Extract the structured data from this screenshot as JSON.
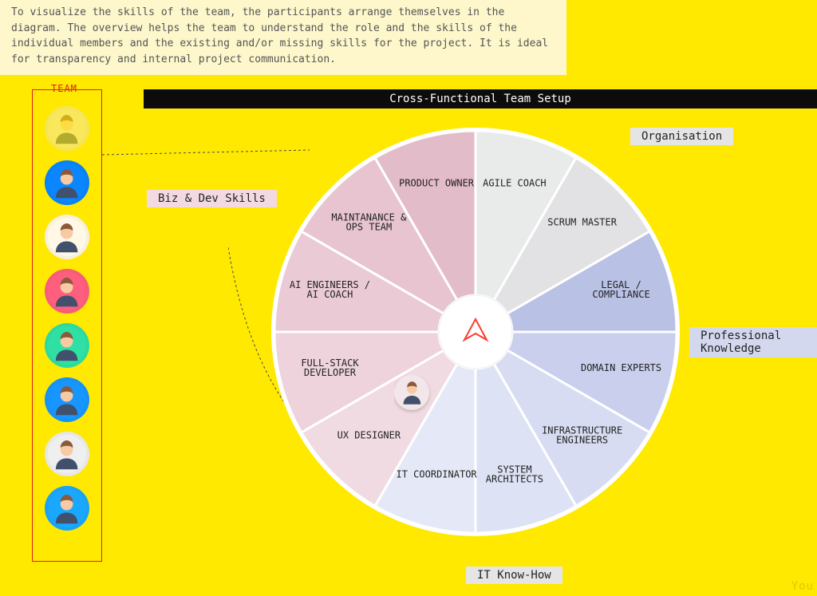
{
  "intro": "To visualize the skills of the team, the participants arrange themselves in the diagram. The overview helps the team to understand the role and the skills of the individual members and the existing and/or missing skills for the project. It is ideal for transparency and internal project communication.",
  "title": "Cross-Functional Team Setup",
  "team_caption": "TEAM",
  "team": [
    {
      "id": "member-1",
      "bg": "#f2e6ea"
    },
    {
      "id": "member-2",
      "bg": "#0a86ff"
    },
    {
      "id": "member-3",
      "bg": "#fff8e7"
    },
    {
      "id": "member-4",
      "bg": "#ff5f7e"
    },
    {
      "id": "member-5",
      "bg": "#2fe0a4"
    },
    {
      "id": "member-6",
      "bg": "#1796ff"
    },
    {
      "id": "member-7",
      "bg": "#efefef"
    },
    {
      "id": "member-8",
      "bg": "#1aa8ff"
    }
  ],
  "quadrants": {
    "top_left": {
      "label": "Biz & Dev Skills"
    },
    "top_right": {
      "label": "Organisation"
    },
    "bottom_right": {
      "label": "Professional Knowledge"
    },
    "bottom_left": {
      "label": "IT Know-How"
    }
  },
  "watermark": "You",
  "chart_data": {
    "type": "pie",
    "title": "Cross-Functional Team Setup",
    "slices": [
      {
        "id": "agile-coach",
        "label": "AGILE COACH",
        "group": "Organisation",
        "color": "#e9eaea"
      },
      {
        "id": "scrum-master",
        "label": "SCRUM MASTER",
        "group": "Organisation",
        "color": "#e2e2e4"
      },
      {
        "id": "legal",
        "label": "LEGAL / COMPLIANCE",
        "group": "Professional Knowledge",
        "color": "#b9c1e5"
      },
      {
        "id": "domain-experts",
        "label": "DOMAIN EXPERTS",
        "group": "Professional Knowledge",
        "color": "#c9cfed"
      },
      {
        "id": "infra-eng",
        "label": "INFRASTRUCTURE ENGINEERS",
        "group": "IT Know-How",
        "color": "#d7dcf2"
      },
      {
        "id": "sys-arch",
        "label": "SYSTEM ARCHITECTS",
        "group": "IT Know-How",
        "color": "#dde2f5"
      },
      {
        "id": "it-coord",
        "label": "IT COORDINATOR",
        "group": "IT Know-How",
        "color": "#e5e9f7"
      },
      {
        "id": "ux-designer",
        "label": "UX DESIGNER",
        "group": "Biz & Dev Skills",
        "color": "#f1dbe2"
      },
      {
        "id": "full-stack",
        "label": "FULL-STACK DEVELOPER",
        "group": "Biz & Dev Skills",
        "color": "#eed3dc"
      },
      {
        "id": "ai-eng",
        "label": "AI ENGINEERS / AI COACH",
        "group": "Biz & Dev Skills",
        "color": "#eacbd5"
      },
      {
        "id": "maint-ops",
        "label": "MAINTANANCE & OPS TEAM",
        "group": "Biz & Dev Skills",
        "color": "#e7c4cf"
      },
      {
        "id": "product-owner",
        "label": "PRODUCT OWNER",
        "group": "Biz & Dev Skills",
        "color": "#e3bcc9"
      }
    ],
    "placed_member": {
      "avatar": "member-1",
      "slice": "ux-designer"
    },
    "values_equal": true
  }
}
